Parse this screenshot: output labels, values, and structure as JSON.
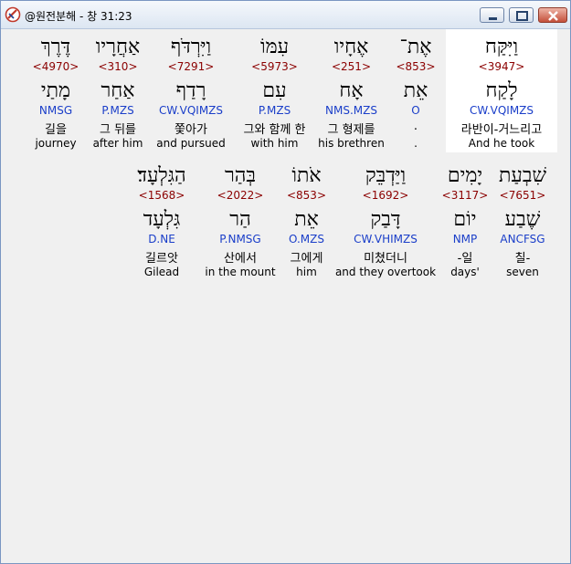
{
  "window": {
    "title": "@원전분해 - 창 31:23"
  },
  "rows": [
    {
      "words": [
        {
          "heb": "וַיִּקַּח",
          "strong": "<3947>",
          "lex": "לָקַח",
          "parse": "CW.VQIMZS",
          "kor": "라반이-거느리고",
          "eng": "And he took",
          "selected": true
        },
        {
          "heb": "אֶת־",
          "strong": "<853>",
          "lex": "אֵת",
          "parse": "O",
          "kor": ".",
          "eng": ".",
          "selected": false
        },
        {
          "heb": "אֶחָיו",
          "strong": "<251>",
          "lex": "אָח",
          "parse": "NMS.MZS",
          "kor": "그 형제를",
          "eng": "his brethren",
          "selected": false
        },
        {
          "heb": "עִמּוֹ",
          "strong": "<5973>",
          "lex": "עִם",
          "parse": "P.MZS",
          "kor": "그와 함께 한",
          "eng": "with him",
          "selected": false
        },
        {
          "heb": "וַיִּרְדֹּף",
          "strong": "<7291>",
          "lex": "רָדַף",
          "parse": "CW.VQIMZS",
          "kor": "쫓아가",
          "eng": "and pursued",
          "selected": false
        },
        {
          "heb": "אַחֲרָיו",
          "strong": "<310>",
          "lex": "אַחַר",
          "parse": "P.MZS",
          "kor": "그 뒤를",
          "eng": "after him",
          "selected": false
        },
        {
          "heb": "דֶּרֶךְ",
          "strong": "<4970>",
          "lex": "מָתַי",
          "parse": "NMSG",
          "kor": "길을",
          "eng": "journey",
          "selected": false
        }
      ]
    },
    {
      "words": [
        {
          "heb": "שִׁבְעַת",
          "strong": "<7651>",
          "lex": "שֶׁבַע",
          "parse": "ANCFSG",
          "kor": "칠-",
          "eng": "seven",
          "selected": false
        },
        {
          "heb": "יָמִים",
          "strong": "<3117>",
          "lex": "יוֹם",
          "parse": "NMP",
          "kor": "-일",
          "eng": "days'",
          "selected": false
        },
        {
          "heb": "וַיַּדְבֵּק",
          "strong": "<1692>",
          "lex": "דָּבַק",
          "parse": "CW.VHIMZS",
          "kor": "미쳤더니",
          "eng": "and they overtook",
          "selected": false
        },
        {
          "heb": "אֹתוֹ",
          "strong": "<853>",
          "lex": "אֵת",
          "parse": "O.MZS",
          "kor": "그에게",
          "eng": "him",
          "selected": false
        },
        {
          "heb": "בְּהַר",
          "strong": "<2022>",
          "lex": "הַר",
          "parse": "P.NMSG",
          "kor": "산에서",
          "eng": "in the mount",
          "selected": false
        },
        {
          "heb": "הַגִּלְעָד׃",
          "strong": "<1568>",
          "lex": "גִּלְעָד",
          "parse": "D.NE",
          "kor": "길르앗",
          "eng": "Gilead",
          "selected": false
        }
      ]
    }
  ],
  "colors": {
    "strong": "#8b0000",
    "parse": "#1a3ec9",
    "selected_bg": "#ffffff"
  }
}
